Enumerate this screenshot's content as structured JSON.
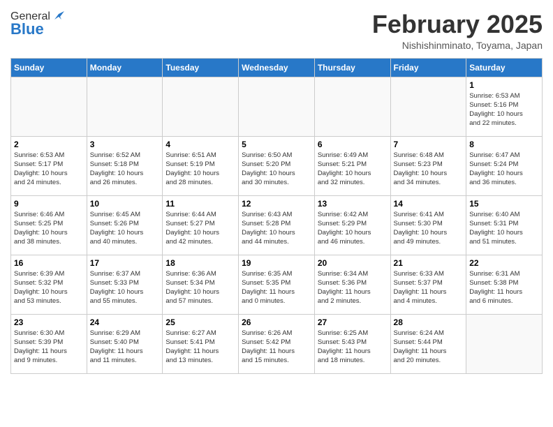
{
  "header": {
    "logo_general": "General",
    "logo_blue": "Blue",
    "month": "February 2025",
    "location": "Nishishinminato, Toyama, Japan"
  },
  "days_of_week": [
    "Sunday",
    "Monday",
    "Tuesday",
    "Wednesday",
    "Thursday",
    "Friday",
    "Saturday"
  ],
  "weeks": [
    [
      {
        "day": "",
        "info": ""
      },
      {
        "day": "",
        "info": ""
      },
      {
        "day": "",
        "info": ""
      },
      {
        "day": "",
        "info": ""
      },
      {
        "day": "",
        "info": ""
      },
      {
        "day": "",
        "info": ""
      },
      {
        "day": "1",
        "info": "Sunrise: 6:53 AM\nSunset: 5:16 PM\nDaylight: 10 hours\nand 22 minutes."
      }
    ],
    [
      {
        "day": "2",
        "info": "Sunrise: 6:53 AM\nSunset: 5:17 PM\nDaylight: 10 hours\nand 24 minutes."
      },
      {
        "day": "3",
        "info": "Sunrise: 6:52 AM\nSunset: 5:18 PM\nDaylight: 10 hours\nand 26 minutes."
      },
      {
        "day": "4",
        "info": "Sunrise: 6:51 AM\nSunset: 5:19 PM\nDaylight: 10 hours\nand 28 minutes."
      },
      {
        "day": "5",
        "info": "Sunrise: 6:50 AM\nSunset: 5:20 PM\nDaylight: 10 hours\nand 30 minutes."
      },
      {
        "day": "6",
        "info": "Sunrise: 6:49 AM\nSunset: 5:21 PM\nDaylight: 10 hours\nand 32 minutes."
      },
      {
        "day": "7",
        "info": "Sunrise: 6:48 AM\nSunset: 5:23 PM\nDaylight: 10 hours\nand 34 minutes."
      },
      {
        "day": "8",
        "info": "Sunrise: 6:47 AM\nSunset: 5:24 PM\nDaylight: 10 hours\nand 36 minutes."
      }
    ],
    [
      {
        "day": "9",
        "info": "Sunrise: 6:46 AM\nSunset: 5:25 PM\nDaylight: 10 hours\nand 38 minutes."
      },
      {
        "day": "10",
        "info": "Sunrise: 6:45 AM\nSunset: 5:26 PM\nDaylight: 10 hours\nand 40 minutes."
      },
      {
        "day": "11",
        "info": "Sunrise: 6:44 AM\nSunset: 5:27 PM\nDaylight: 10 hours\nand 42 minutes."
      },
      {
        "day": "12",
        "info": "Sunrise: 6:43 AM\nSunset: 5:28 PM\nDaylight: 10 hours\nand 44 minutes."
      },
      {
        "day": "13",
        "info": "Sunrise: 6:42 AM\nSunset: 5:29 PM\nDaylight: 10 hours\nand 46 minutes."
      },
      {
        "day": "14",
        "info": "Sunrise: 6:41 AM\nSunset: 5:30 PM\nDaylight: 10 hours\nand 49 minutes."
      },
      {
        "day": "15",
        "info": "Sunrise: 6:40 AM\nSunset: 5:31 PM\nDaylight: 10 hours\nand 51 minutes."
      }
    ],
    [
      {
        "day": "16",
        "info": "Sunrise: 6:39 AM\nSunset: 5:32 PM\nDaylight: 10 hours\nand 53 minutes."
      },
      {
        "day": "17",
        "info": "Sunrise: 6:37 AM\nSunset: 5:33 PM\nDaylight: 10 hours\nand 55 minutes."
      },
      {
        "day": "18",
        "info": "Sunrise: 6:36 AM\nSunset: 5:34 PM\nDaylight: 10 hours\nand 57 minutes."
      },
      {
        "day": "19",
        "info": "Sunrise: 6:35 AM\nSunset: 5:35 PM\nDaylight: 11 hours\nand 0 minutes."
      },
      {
        "day": "20",
        "info": "Sunrise: 6:34 AM\nSunset: 5:36 PM\nDaylight: 11 hours\nand 2 minutes."
      },
      {
        "day": "21",
        "info": "Sunrise: 6:33 AM\nSunset: 5:37 PM\nDaylight: 11 hours\nand 4 minutes."
      },
      {
        "day": "22",
        "info": "Sunrise: 6:31 AM\nSunset: 5:38 PM\nDaylight: 11 hours\nand 6 minutes."
      }
    ],
    [
      {
        "day": "23",
        "info": "Sunrise: 6:30 AM\nSunset: 5:39 PM\nDaylight: 11 hours\nand 9 minutes."
      },
      {
        "day": "24",
        "info": "Sunrise: 6:29 AM\nSunset: 5:40 PM\nDaylight: 11 hours\nand 11 minutes."
      },
      {
        "day": "25",
        "info": "Sunrise: 6:27 AM\nSunset: 5:41 PM\nDaylight: 11 hours\nand 13 minutes."
      },
      {
        "day": "26",
        "info": "Sunrise: 6:26 AM\nSunset: 5:42 PM\nDaylight: 11 hours\nand 15 minutes."
      },
      {
        "day": "27",
        "info": "Sunrise: 6:25 AM\nSunset: 5:43 PM\nDaylight: 11 hours\nand 18 minutes."
      },
      {
        "day": "28",
        "info": "Sunrise: 6:24 AM\nSunset: 5:44 PM\nDaylight: 11 hours\nand 20 minutes."
      },
      {
        "day": "",
        "info": ""
      }
    ]
  ]
}
